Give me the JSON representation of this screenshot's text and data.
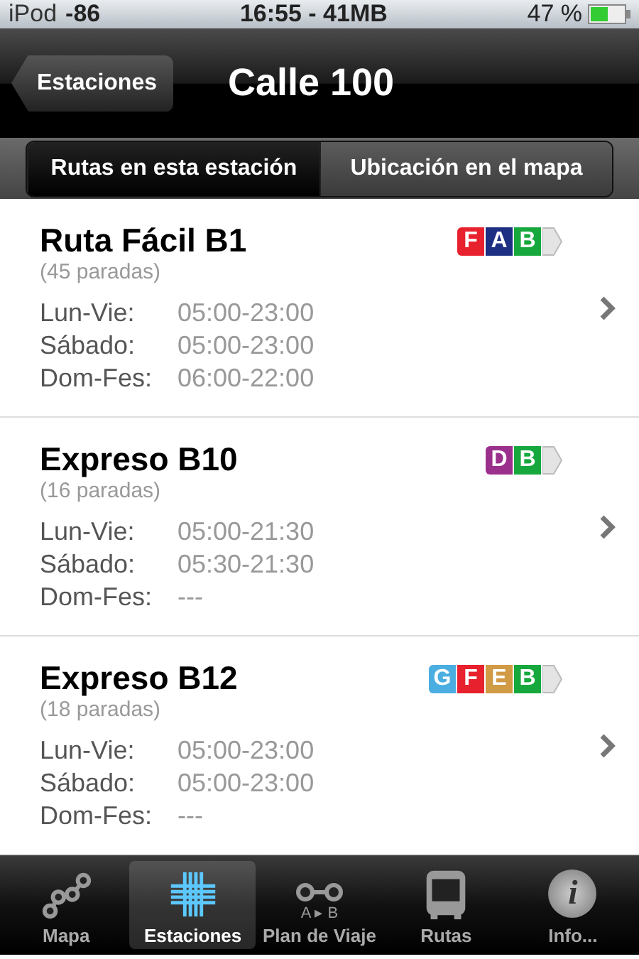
{
  "status_bar": {
    "carrier": "iPod",
    "signal": "-86",
    "time": "16:55 - 41MB",
    "battery": "47 %"
  },
  "nav": {
    "back": "Estaciones",
    "title": "Calle 100"
  },
  "segments": [
    {
      "label": "Rutas en esta estación",
      "selected": true
    },
    {
      "label": "Ubicación en el mapa",
      "selected": false
    }
  ],
  "routes": [
    {
      "name": "Ruta Fácil B1",
      "stops": "(45 paradas)",
      "zones": [
        {
          "letter": "F",
          "color": "#e8212e"
        },
        {
          "letter": "A",
          "color": "#1d2f83"
        },
        {
          "letter": "B",
          "color": "#16a83c"
        }
      ],
      "schedule": [
        {
          "day": "Lun-Vie:",
          "hours": "05:00-23:00"
        },
        {
          "day": "Sábado:",
          "hours": "05:00-23:00"
        },
        {
          "day": "Dom-Fes:",
          "hours": "06:00-22:00"
        }
      ]
    },
    {
      "name": "Expreso B10",
      "stops": "(16 paradas)",
      "zones": [
        {
          "letter": "D",
          "color": "#9b2f8c"
        },
        {
          "letter": "B",
          "color": "#16a83c"
        }
      ],
      "schedule": [
        {
          "day": "Lun-Vie:",
          "hours": "05:00-21:30"
        },
        {
          "day": "Sábado:",
          "hours": "05:30-21:30"
        },
        {
          "day": "Dom-Fes:",
          "hours": "---"
        }
      ]
    },
    {
      "name": "Expreso B12",
      "stops": "(18 paradas)",
      "zones": [
        {
          "letter": "G",
          "color": "#4aaee0"
        },
        {
          "letter": "F",
          "color": "#e8212e"
        },
        {
          "letter": "E",
          "color": "#d19a45"
        },
        {
          "letter": "B",
          "color": "#16a83c"
        }
      ],
      "schedule": [
        {
          "day": "Lun-Vie:",
          "hours": "05:00-23:00"
        },
        {
          "day": "Sábado:",
          "hours": "05:00-23:00"
        },
        {
          "day": "Dom-Fes:",
          "hours": "---"
        }
      ]
    }
  ],
  "tab_bar": [
    {
      "kind": "map",
      "label": "Mapa",
      "selected": false
    },
    {
      "kind": "stations",
      "label": "Estaciones",
      "selected": true
    },
    {
      "kind": "trip",
      "label": "Plan de Viaje",
      "selected": false,
      "icon_text": "A ▸ B"
    },
    {
      "kind": "bus",
      "label": "Rutas",
      "selected": false
    },
    {
      "kind": "info",
      "label": "Info...",
      "selected": false,
      "icon_text": "i"
    }
  ]
}
